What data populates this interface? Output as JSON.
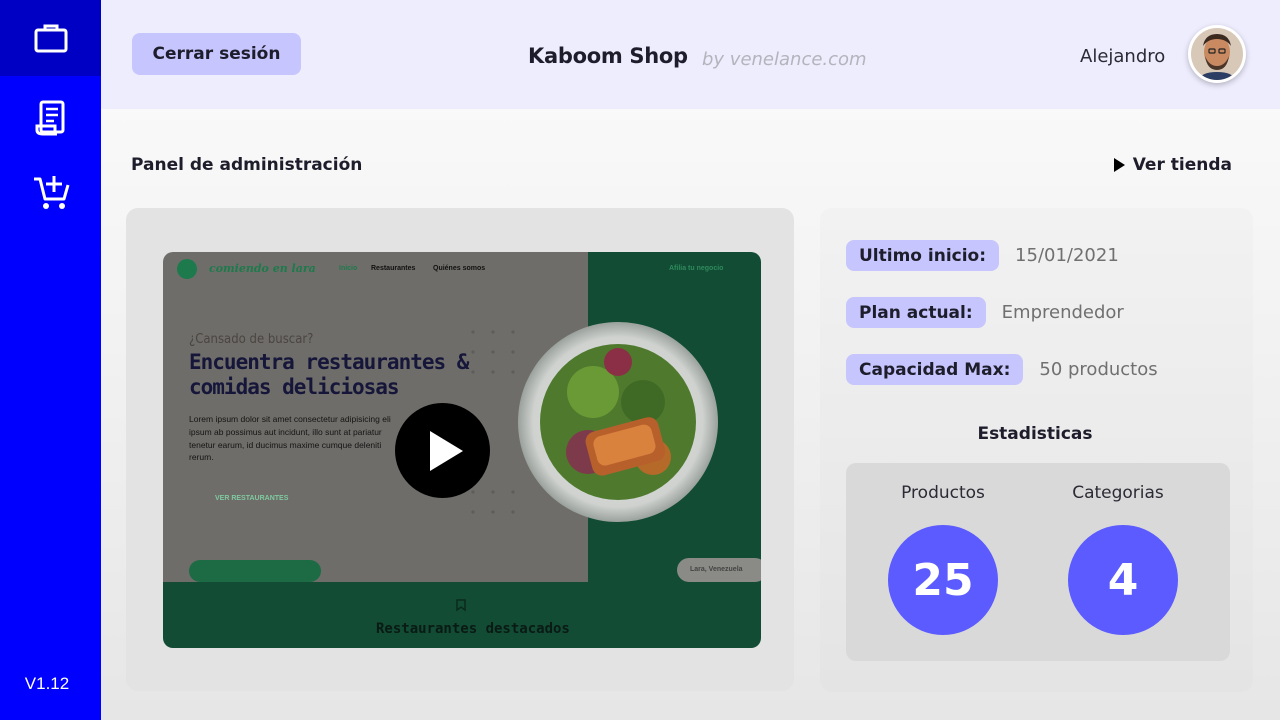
{
  "sidebar": {
    "items": [
      {
        "icon": "briefcase-icon",
        "active": true
      },
      {
        "icon": "receipt-icon",
        "active": false
      },
      {
        "icon": "cart-add-icon",
        "active": false
      }
    ],
    "version": "V1.12"
  },
  "header": {
    "logout_label": "Cerrar sesión",
    "brand": "Kaboom Shop",
    "brand_sub": "by venelance.com",
    "user_name": "Alejandro"
  },
  "main": {
    "title": "Panel de administración",
    "view_store_label": "Ver tienda"
  },
  "video": {
    "thumbnail": {
      "site_logo": "comiendo en lara",
      "nav": [
        "Inicio",
        "Restaurantes",
        "Quiénes somos"
      ],
      "nav_right": "Afilia tu negocio",
      "eyebrow": "¿Cansado de buscar?",
      "headline_1": "Encuentra restaurantes &",
      "headline_2": "comidas deliciosas",
      "body_1": "Lorem ipsum dolor sit amet consectetur adipisicing eli",
      "body_2": "ipsum ab possimus aut incidunt, illo sunt at pariatur",
      "body_3": "tenetur earum, id ducimus maxime cumque deleniti",
      "body_4": "rerum.",
      "cta": "VER RESTAURANTES",
      "location_pill": "Lara, Venezuela",
      "section_title": "Restaurantes destacados"
    }
  },
  "info": {
    "rows": [
      {
        "label": "Ultimo inicio:",
        "value": "15/01/2021"
      },
      {
        "label": "Plan actual:",
        "value": "Emprendedor"
      },
      {
        "label": "Capacidad Max:",
        "value": "50 productos"
      }
    ],
    "stats_title": "Estadisticas",
    "stats": [
      {
        "label": "Productos",
        "value": "25"
      },
      {
        "label": "Categorias",
        "value": "4"
      }
    ]
  },
  "colors": {
    "sidebar": "#0000ff",
    "sidebar_active": "#0000c4",
    "header_bg": "#ededfe",
    "chip": "#c6c5fd",
    "stat_circle": "#5b5bff",
    "video_green": "#124c35"
  }
}
